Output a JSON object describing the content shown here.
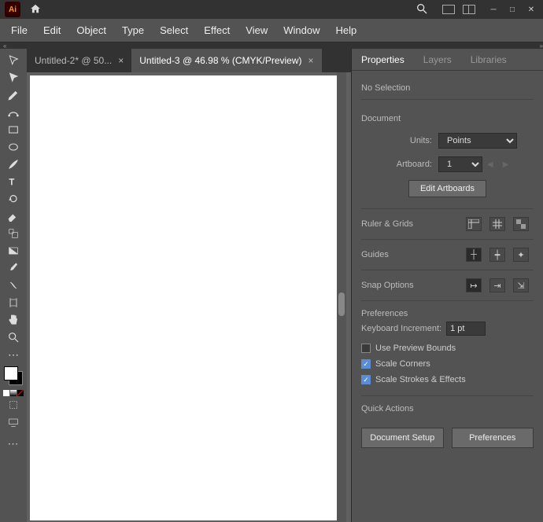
{
  "app_icon_text": "Ai",
  "menus": {
    "file": "File",
    "edit": "Edit",
    "object": "Object",
    "type": "Type",
    "select": "Select",
    "effect": "Effect",
    "view": "View",
    "window": "Window",
    "help": "Help"
  },
  "tabs": [
    {
      "title": "Untitled-2* @ 50...",
      "active": false
    },
    {
      "title": "Untitled-3 @ 46.98 % (CMYK/Preview)",
      "active": true
    }
  ],
  "panel": {
    "tabs": {
      "properties": "Properties",
      "layers": "Layers",
      "libraries": "Libraries"
    },
    "selection": "No Selection",
    "document": {
      "heading": "Document",
      "units_label": "Units:",
      "units_value": "Points",
      "artboard_label": "Artboard:",
      "artboard_value": "1",
      "edit_artboards": "Edit Artboards"
    },
    "ruler_grids": "Ruler & Grids",
    "guides": "Guides",
    "snap_options": "Snap Options",
    "preferences": {
      "heading": "Preferences",
      "keyboard_increment_label": "Keyboard Increment:",
      "keyboard_increment_value": "1 pt",
      "use_preview_bounds": "Use Preview Bounds",
      "scale_corners": "Scale Corners",
      "scale_strokes": "Scale Strokes & Effects"
    },
    "quick_actions": {
      "heading": "Quick Actions",
      "document_setup": "Document Setup",
      "preferences": "Preferences"
    }
  }
}
